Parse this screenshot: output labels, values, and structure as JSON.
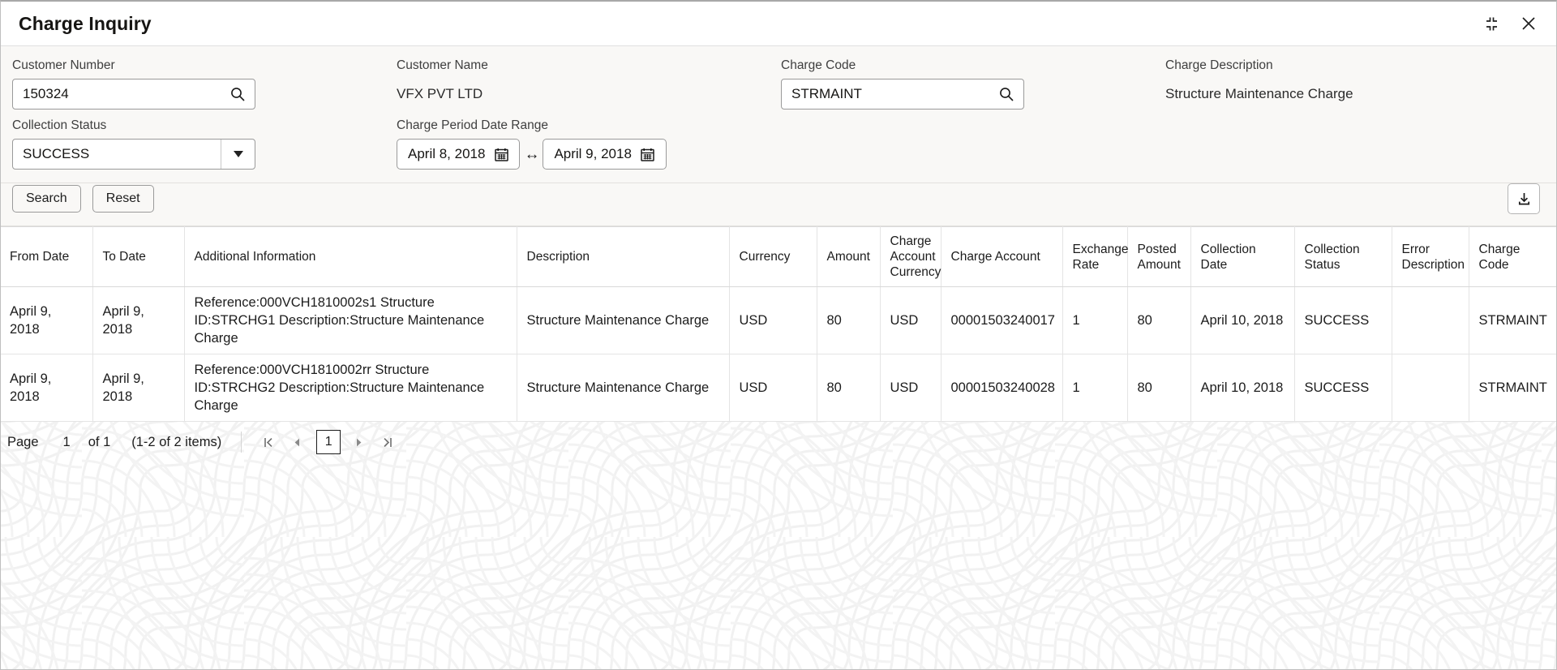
{
  "window": {
    "title": "Charge Inquiry",
    "minimize_icon": "collapse-corners-icon",
    "close_icon": "close-icon"
  },
  "filters": {
    "customer_number": {
      "label": "Customer Number",
      "value": "150324",
      "icon": "search-icon"
    },
    "customer_name": {
      "label": "Customer Name",
      "value": "VFX PVT LTD"
    },
    "charge_code": {
      "label": "Charge Code",
      "value": "STRMAINT",
      "icon": "search-icon"
    },
    "charge_description": {
      "label": "Charge Description",
      "value": "Structure Maintenance Charge"
    },
    "collection_status": {
      "label": "Collection Status",
      "value": "SUCCESS",
      "caret_icon": "chevron-down-icon"
    },
    "charge_period": {
      "label": "Charge Period Date Range",
      "from": "April 8, 2018",
      "to": "April 9, 2018",
      "separator": "↔",
      "calendar_icon": "calendar-icon"
    }
  },
  "toolbar": {
    "search_label": "Search",
    "reset_label": "Reset",
    "download_icon": "download-icon"
  },
  "table": {
    "columns": [
      "From Date",
      "To Date",
      "Additional Information",
      "Description",
      "Currency",
      "Amount",
      "Charge Account Currency",
      "Charge Account",
      "Exchange Rate",
      "Posted Amount",
      "Collection Date",
      "Collection Status",
      "Error Description",
      "Charge Code"
    ],
    "rows": [
      {
        "from_date": "April 9, 2018",
        "to_date": "April 9, 2018",
        "additional_information": "Reference:000VCH1810002s1 Structure ID:STRCHG1 Description:Structure Maintenance Charge",
        "description": "Structure Maintenance Charge",
        "currency": "USD",
        "amount": "80",
        "charge_account_currency": "USD",
        "charge_account": "00001503240017",
        "exchange_rate": "1",
        "posted_amount": "80",
        "collection_date": "April 10, 2018",
        "collection_status": "SUCCESS",
        "error_description": "",
        "charge_code": "STRMAINT"
      },
      {
        "from_date": "April 9, 2018",
        "to_date": "April 9, 2018",
        "additional_information": "Reference:000VCH1810002rr Structure ID:STRCHG2 Description:Structure Maintenance Charge",
        "description": "Structure Maintenance Charge",
        "currency": "USD",
        "amount": "80",
        "charge_account_currency": "USD",
        "charge_account": "00001503240028",
        "exchange_rate": "1",
        "posted_amount": "80",
        "collection_date": "April 10, 2018",
        "collection_status": "SUCCESS",
        "error_description": "",
        "charge_code": "STRMAINT"
      }
    ]
  },
  "pagination": {
    "page_label": "Page",
    "current_page": "1",
    "of_label": "of 1",
    "items_label": "(1-2 of 2 items)",
    "first_icon": "first-page-icon",
    "prev_icon": "prev-page-icon",
    "page_box": "1",
    "next_icon": "next-page-icon",
    "last_icon": "last-page-icon"
  },
  "colors": {
    "panel_bg": "#f9f8f6",
    "table_bg": "#ffffff",
    "border": "#9a9a9a",
    "text": "#161513"
  }
}
